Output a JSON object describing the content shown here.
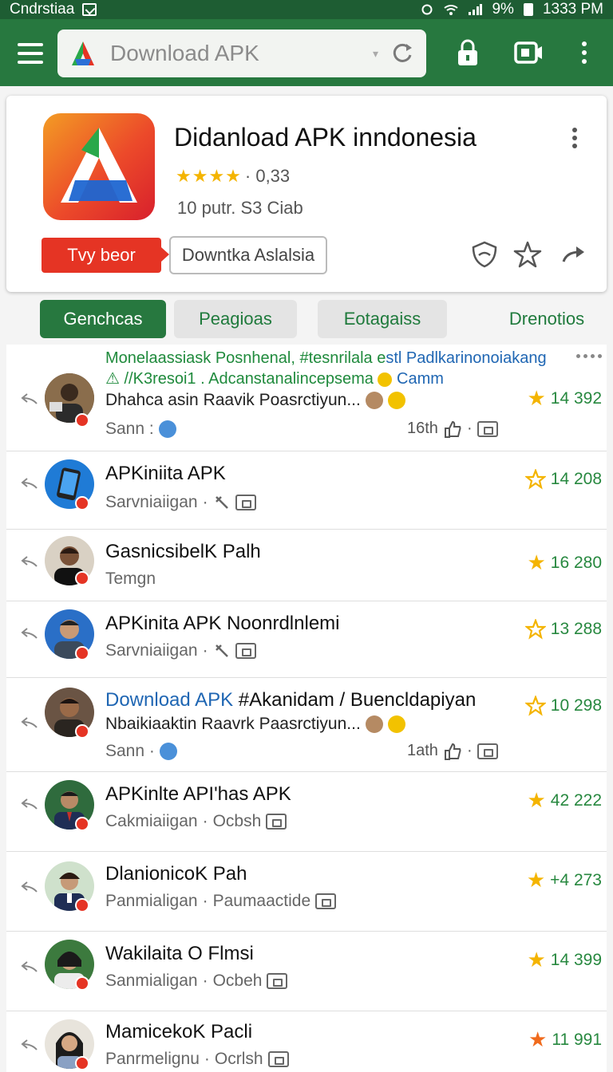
{
  "status_bar": {
    "carrier": "Cndrstiaa",
    "battery": "9%",
    "time": "1333 PM"
  },
  "toolbar": {
    "search_text": "Download APK"
  },
  "app_card": {
    "title": "Didanload APK inndonesia",
    "rating_stars": "★★★★",
    "rating_value": "· 0,33",
    "meta": "10 putr. S3 Ciab",
    "primary_button": "Tvy beor",
    "secondary_button": "Downtka Aslalsia"
  },
  "tabs": [
    {
      "label": "Genchcas"
    },
    {
      "label": "Peagioas"
    },
    {
      "label": "Eotagaiss"
    },
    {
      "label": "Drenotios"
    }
  ],
  "list": {
    "featured": {
      "tag1": "Monelaassiask Posnhenal, #tesnrilala e",
      "tag1b": "stl Padlkarinonoiakang",
      "tag2": "⚠ //K3resoi1 . Adcanstanalincepsema",
      "tag2b": "Camm",
      "line": "Dhahca asin Raavik Poasrctiyun...",
      "sub": "Sann :",
      "time": "16th",
      "rating": "14  392"
    },
    "rows": [
      {
        "title": "APKiniita APK",
        "sub": "Sarvniaiigan",
        "rating": "14  208"
      },
      {
        "title": "GasnicsibelK Palh",
        "sub": "Temgn",
        "rating": "16  280"
      },
      {
        "title": "APKinita APK Noonrdlnlemi",
        "sub": "Sarvniaiigan",
        "rating": "13  288"
      },
      {
        "title_accent": "Download  APK",
        "title_rest": " #Akanidam / Buencldapiyan",
        "line": "Nbaikiaaktin Raavrk Paasrctiyun...",
        "sub": "Sann ·",
        "time": "1ath",
        "rating": "10  298"
      },
      {
        "title": "APKinlte API'has APK",
        "sub": "Cakmiaiigan",
        "sub2": "Ocbsh",
        "rating": "42  222"
      },
      {
        "title": "DlanionicoK Pah",
        "sub": "Panmialigan",
        "sub2": "Paumaactide",
        "rating": "+4  273"
      },
      {
        "title": "Wakilaita O Flmsi",
        "sub": "Sanmialigan",
        "sub2": "Ocbeh",
        "rating": "14  399"
      },
      {
        "title": "MamicekoK Pacli",
        "sub": "Panrmelignu",
        "sub2": "Ocrlsh",
        "rating": "11  991"
      }
    ]
  },
  "colors": {
    "brand_green": "#27783f",
    "status_green": "#1e5d33",
    "accent_red": "#e53424",
    "star": "#f4b400"
  }
}
